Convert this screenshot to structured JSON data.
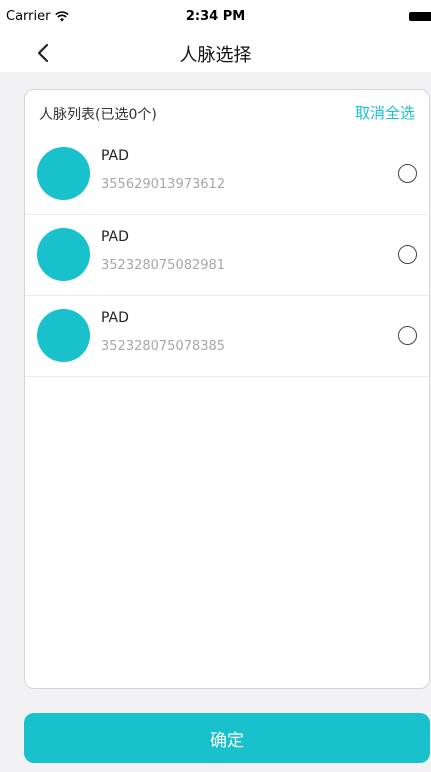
{
  "status_bar": {
    "carrier": "Carrier",
    "time": "2:34 PM",
    "wifi_icon": "wifi-icon",
    "battery_icon": "battery-icon"
  },
  "nav": {
    "title": "人脉选择",
    "back_icon": "chevron-left-icon"
  },
  "list": {
    "title": "人脉列表(已选0个)",
    "deselect_all_label": "取消全选",
    "items": [
      {
        "name": "PAD",
        "id": "355629013973612",
        "selected": false
      },
      {
        "name": "PAD",
        "id": "352328075082981",
        "selected": false
      },
      {
        "name": "PAD",
        "id": "352328075078385",
        "selected": false
      }
    ]
  },
  "confirm_label": "确定",
  "colors": {
    "accent": "#19c1cc",
    "background": "#f2f2f4",
    "secondary_text": "#a7a7a7"
  }
}
